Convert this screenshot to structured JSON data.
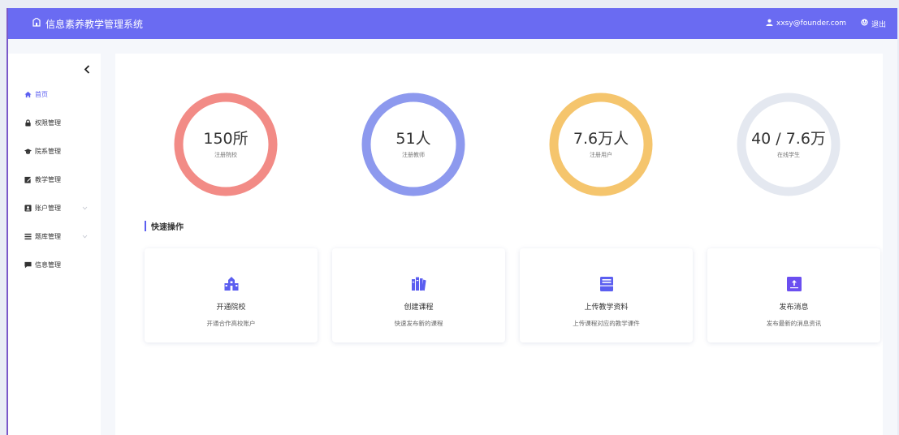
{
  "header": {
    "title": "信息素养教学管理系统",
    "user": "xxsy@founder.com",
    "logout": "退出"
  },
  "sidebar": {
    "items": [
      {
        "label": "首页",
        "icon": "home-icon",
        "active": true
      },
      {
        "label": "权限管理",
        "icon": "lock-icon"
      },
      {
        "label": "院系管理",
        "icon": "graduation-cap-icon"
      },
      {
        "label": "教学管理",
        "icon": "edit-icon"
      },
      {
        "label": "账户管理",
        "icon": "user-card-icon",
        "expandable": true
      },
      {
        "label": "题库管理",
        "icon": "list-icon",
        "expandable": true
      },
      {
        "label": "信息管理",
        "icon": "message-icon"
      }
    ]
  },
  "stats": [
    {
      "value": "150所",
      "label": "注册院校",
      "color": "#f28b86"
    },
    {
      "value": "51人",
      "label": "注册教师",
      "color": "#8d99ee"
    },
    {
      "value": "7.6万人",
      "label": "注册用户",
      "color": "#f5c56d"
    },
    {
      "value": "40 / 7.6万",
      "label": "在线学生",
      "color": "#e4e8f0"
    }
  ],
  "quick_actions": {
    "title": "快速操作",
    "cards": [
      {
        "title": "开通院校",
        "desc": "开通合作高校账户",
        "icon": "school-building-icon"
      },
      {
        "title": "创建课程",
        "desc": "快速发布新的课程",
        "icon": "books-icon"
      },
      {
        "title": "上传教学资料",
        "desc": "上传课程对应的教学课件",
        "icon": "document-tray-icon"
      },
      {
        "title": "发布消息",
        "desc": "发布最新的消息资讯",
        "icon": "upload-message-icon"
      }
    ]
  },
  "colors": {
    "header": "#6a6bf2",
    "accent": "#5b5ef0"
  }
}
